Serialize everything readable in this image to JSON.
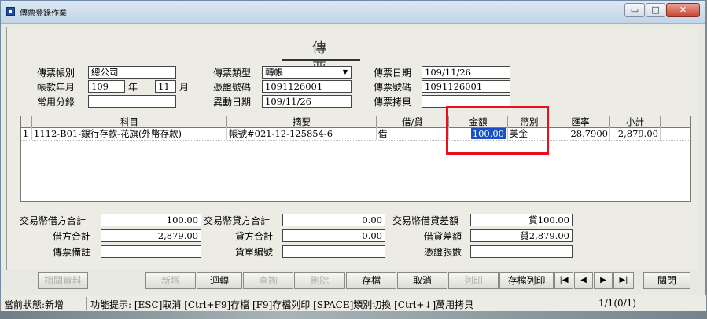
{
  "window": {
    "title": "傳票登錄作業",
    "buttons": {
      "min": "▭",
      "max": "□",
      "close": "✕"
    }
  },
  "heading": "傳　票",
  "fields": {
    "account_label": "傳票帳別",
    "account_value": "總公司",
    "ym_label": "帳款年月",
    "year_value": "109",
    "year_unit": "年",
    "month_value": "11",
    "month_unit": "月",
    "summary_label": "常用分錄",
    "summary_value": "",
    "type_label": "傳票類型",
    "type_value": "轉帳",
    "voucher_no_label": "憑證號碼",
    "voucher_no_value": "1091126001",
    "change_date_label": "異動日期",
    "change_date_value": "109/11/26",
    "date_label": "傳票日期",
    "date_value": "109/11/26",
    "number_label": "傳票號碼",
    "number_value": "1091126001",
    "copy_label": "傳票拷貝",
    "copy_value": ""
  },
  "grid": {
    "headers": [
      "科目",
      "摘要",
      "借/貸",
      "金額",
      "幣別",
      "匯率",
      "小計"
    ],
    "rows": [
      {
        "no": "1",
        "subject": "1112-B01-銀行存款-花旗(外幣存款)",
        "memo": "帳號#021-12-125854-6",
        "dc": "借",
        "amount": "100.00",
        "currency": "美金",
        "rate": "28.7900",
        "subtotal": "2,879.00"
      }
    ]
  },
  "totals": {
    "fx_debit_label": "交易幣借方合計",
    "fx_debit_value": "100.00",
    "fx_credit_label": "交易幣貸方合計",
    "fx_credit_value": "0.00",
    "fx_diff_label": "交易幣借貸差額",
    "fx_diff_value": "貸100.00",
    "debit_label": "借方合計",
    "debit_value": "2,879.00",
    "credit_label": "貸方合計",
    "credit_value": "0.00",
    "diff_label": "借貸差額",
    "diff_value": "貸2,879.00",
    "remark_label": "傳票備註",
    "remark_value": "",
    "bill_label": "貨單編號",
    "bill_value": "",
    "voucher_count_label": "憑證張數",
    "voucher_count_value": ""
  },
  "buttons": {
    "related": "相關資料",
    "add": "新增",
    "back": "迴轉",
    "query": "查詢",
    "delete": "刪除",
    "save": "存檔",
    "cancel": "取消",
    "print": "列印",
    "save_print": "存檔列印",
    "first": "|◀",
    "prev": "◀",
    "next": "▶",
    "last": "▶|",
    "close": "關閉"
  },
  "status": {
    "state": "當前狀態:新增",
    "hint": "功能提示: [ESC]取消 [Ctrl+F9]存檔 [F9]存檔列印 [SPACE]類別切換 [Ctrl+↓]萬用拷貝",
    "page": "1/1(0/1)"
  }
}
